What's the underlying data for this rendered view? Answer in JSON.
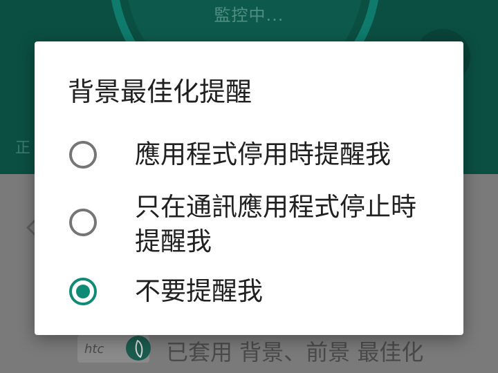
{
  "background": {
    "status_text": "監控中...",
    "side_char": "正",
    "htc_logo": "htc",
    "bottom_text": "已套用 背景、前景 最佳化"
  },
  "dialog": {
    "title": "背景最佳化提醒",
    "options": [
      {
        "label": "應用程式停用時提醒我",
        "selected": false
      },
      {
        "label": "只在通訊應用程式停止時提醒我",
        "selected": false
      },
      {
        "label": "不要提醒我",
        "selected": true
      }
    ]
  },
  "colors": {
    "accent": "#0f8a74",
    "header_dimmed": "#0b4f42",
    "scrim": "#7a7a7a"
  },
  "icons": {
    "radio_unchecked": "radio-unchecked-icon",
    "radio_checked": "radio-checked-icon",
    "leaf": "leaf-icon",
    "back": "chevron-left-icon"
  }
}
